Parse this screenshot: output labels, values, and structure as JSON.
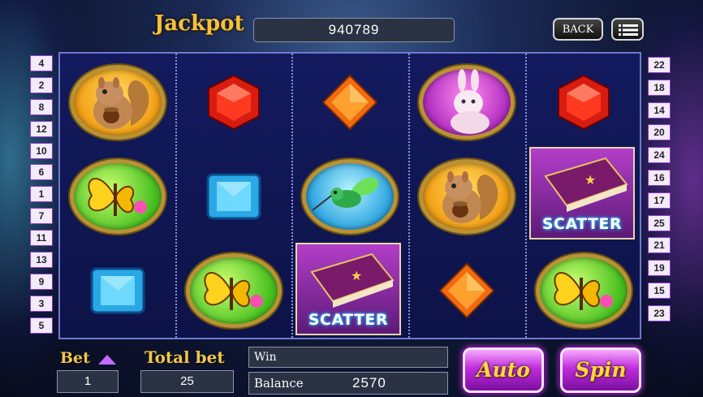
{
  "header": {
    "jackpot_label": "Jackpot",
    "jackpot_value": "940789",
    "back_label": "BACK",
    "menu_icon": "menu-list-icon"
  },
  "lines": {
    "left": [
      "4",
      "2",
      "8",
      "12",
      "10",
      "6",
      "1",
      "7",
      "11",
      "13",
      "9",
      "3",
      "5"
    ],
    "right": [
      "22",
      "18",
      "14",
      "20",
      "24",
      "16",
      "17",
      "25",
      "21",
      "19",
      "15",
      "23"
    ]
  },
  "reels": [
    [
      "squirrel",
      "butterfly",
      "blue-gem"
    ],
    [
      "red-gem",
      "blue-gem",
      "butterfly"
    ],
    [
      "orange-gem",
      "hummingbird",
      "scatter"
    ],
    [
      "rabbit",
      "squirrel",
      "orange-gem"
    ],
    [
      "red-gem",
      "scatter",
      "butterfly"
    ]
  ],
  "scatter_label": "SCATTER",
  "footer": {
    "bet_label": "Bet",
    "bet_value": "1",
    "total_bet_label": "Total bet",
    "total_bet_value": "25",
    "win_label": "Win",
    "win_value": "",
    "balance_label": "Balance",
    "balance_value": "2570",
    "auto_label": "Auto",
    "spin_label": "Spin"
  }
}
